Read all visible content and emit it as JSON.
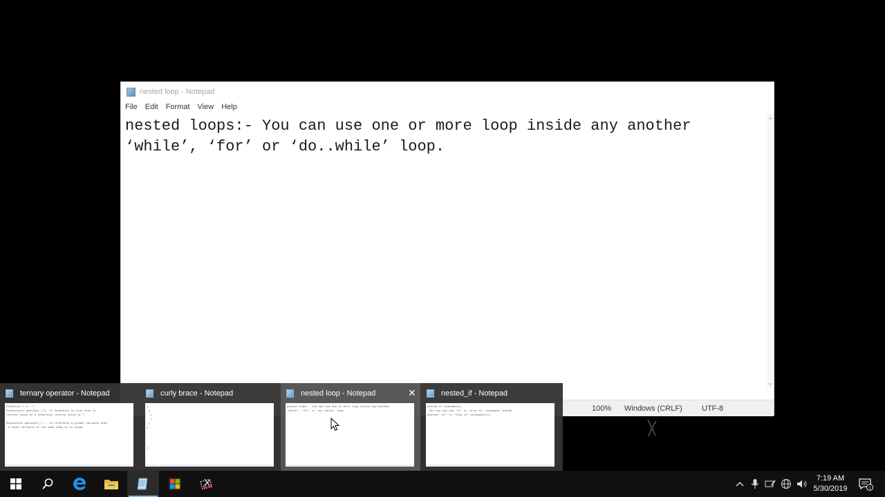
{
  "notepad": {
    "title": "nested loop - Notepad",
    "menu": [
      "File",
      "Edit",
      "Format",
      "View",
      "Help"
    ],
    "content": "nested loops:- You can use one or more loop inside any another\n‘while’, ‘for’ or ‘do..while’ loop.",
    "status": {
      "zoom": "100%",
      "line_ending": "Windows (CRLF)",
      "encoding": "UTF-8"
    }
  },
  "flyout": {
    "thumbnails": [
      {
        "title": "ternary operator - Notepad",
        "preview": "Condition ? X : Y\nConditional operator (?). If Condition is true then it\nreturns value of X otherwise returns value of Y.\n\nResolution operator(::) - to reference a global variable when\n a local variable of the same name is in scope."
      },
      {
        "title": "curly brace - Notepad",
        "preview": "{\n {\n  {\n  }\n }\n}\n\n\n\n\n}"
      },
      {
        "title": "nested loop - Notepad",
        "preview": "nested loops:- You can use one or more loop inside any another\n'while', 'for' or 'do..while' loop."
      },
      {
        "title": "nested_if - Notepad",
        "preview": "nested if statements-\n You can use one 'if' or 'else if' statement inside\nanother 'if' or 'else if' statement(s)."
      }
    ],
    "hovered_index": 2
  },
  "taskbar": {
    "apps": [
      "start-icon",
      "search-icon",
      "edge-icon",
      "file-explorer-icon",
      "notepad-icon",
      "store-icon",
      "snipping-tool-icon"
    ],
    "active_app": "notepad-icon",
    "tray": [
      "chevron-up-icon",
      "microphone-icon",
      "pen-icon",
      "network-icon",
      "volume-icon"
    ],
    "clock": {
      "time": "7:19 AM",
      "date": "5/30/2019"
    },
    "notification_count": "1"
  }
}
